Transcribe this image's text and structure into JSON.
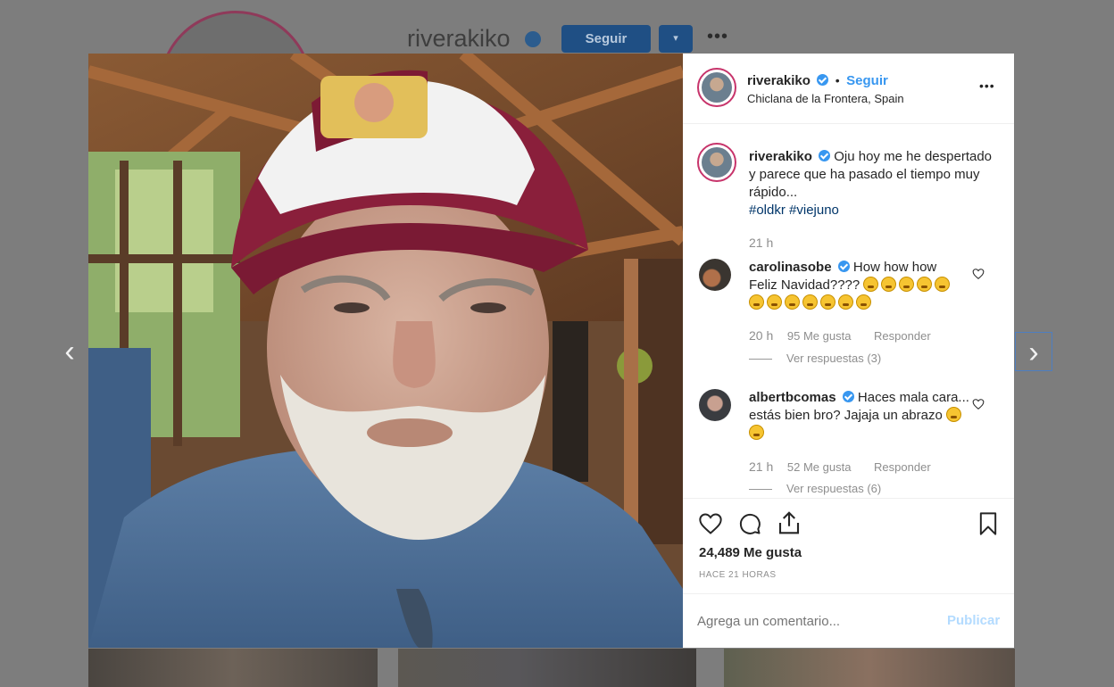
{
  "background_profile": {
    "username": "riverakiko",
    "follow_label": "Seguir",
    "dropdown_label": "▾",
    "more_label": "•••"
  },
  "nav": {
    "prev": "‹",
    "next": "›"
  },
  "post": {
    "username": "riverakiko",
    "follow_label": "Seguir",
    "separator": "•",
    "location": "Chiclana de la Frontera, Spain",
    "more_label": "•••",
    "caption": {
      "username": "riverakiko",
      "text": "Oju hoy me he despertado y parece que ha pasado el tiempo muy rápido...",
      "hashtags": "#oldkr #viejuno",
      "time": "21 h"
    },
    "comments": [
      {
        "username": "carolinasobe",
        "text_line1": "How how how",
        "text_line2": "Feliz Navidad????",
        "time": "20 h",
        "likes": "95 Me gusta",
        "reply": "Responder",
        "view_replies": "Ver respuestas (3)"
      },
      {
        "username": "albertbcomas",
        "text": "Haces mala cara... estás bien bro? Jajaja un abrazo",
        "time": "21 h",
        "likes": "52 Me gusta",
        "reply": "Responder",
        "view_replies": "Ver respuestas (6)"
      }
    ],
    "likes_count": "24,489 Me gusta",
    "timestamp": "HACE 21 HORAS",
    "comment_placeholder": "Agrega un comentario...",
    "publish_label": "Publicar"
  },
  "colors": {
    "accent": "#3897f0",
    "hashtag": "#003569",
    "follow_bg_dimmed": "#1f4f84",
    "avatar_ring": "#c7346b"
  },
  "icons": [
    "heart-icon",
    "comment-icon",
    "share-icon",
    "bookmark-icon",
    "verified-icon",
    "more-icon",
    "chevron-left-icon",
    "chevron-right-icon"
  ]
}
